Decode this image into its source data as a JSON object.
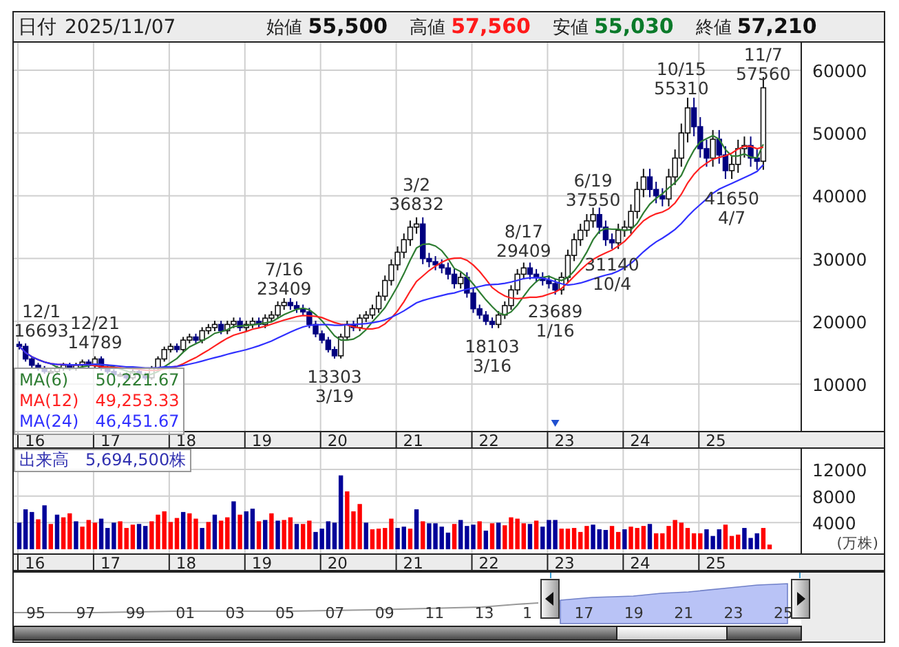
{
  "header": {
    "date_label": "日付",
    "date": "2025/11/07",
    "quotes": [
      {
        "label": "始値",
        "value": "55,500",
        "kind": "neutral"
      },
      {
        "label": "高値",
        "value": "57,560",
        "kind": "up"
      },
      {
        "label": "安値",
        "value": "55,030",
        "kind": "down"
      },
      {
        "label": "終値",
        "value": "57,210",
        "kind": "neutral"
      }
    ]
  },
  "price_chart": {
    "legend": [
      {
        "name": "MA(6)",
        "value": "50,221.67",
        "color": "#2e7d32"
      },
      {
        "name": "MA(12)",
        "value": "49,253.33",
        "color": "#ff2020"
      },
      {
        "name": "MA(24)",
        "value": "46,451.67",
        "color": "#3030ff"
      }
    ],
    "axis_labels": [
      "60000",
      "50000",
      "40000",
      "30000",
      "20000",
      "10000"
    ],
    "annotations": [
      {
        "lines": [
          "12/1",
          "16693"
        ]
      },
      {
        "lines": [
          "12/21",
          "14789"
        ]
      },
      {
        "lines": [
          "7/16",
          "23409"
        ]
      },
      {
        "lines": [
          "13303",
          "3/19"
        ]
      },
      {
        "lines": [
          "3/2",
          "36832"
        ]
      },
      {
        "lines": [
          "18103",
          "3/16"
        ]
      },
      {
        "lines": [
          "8/17",
          "29409"
        ]
      },
      {
        "lines": [
          "23689",
          "1/16"
        ]
      },
      {
        "lines": [
          "6/19",
          "37550"
        ]
      },
      {
        "lines": [
          "31140",
          "10/4"
        ]
      },
      {
        "lines": [
          "10/15",
          "55310"
        ]
      },
      {
        "lines": [
          "41650",
          "4/7"
        ]
      },
      {
        "lines": [
          "11/7",
          "57560"
        ]
      }
    ],
    "x_labels": [
      "16",
      "17",
      "18",
      "19",
      "20",
      "21",
      "22",
      "23",
      "24",
      "25"
    ]
  },
  "volume_chart": {
    "legend_label": "出来高",
    "legend_value": "5,694,500株",
    "x_labels": [
      "16",
      "17",
      "18",
      "19",
      "20",
      "21",
      "22",
      "23",
      "24",
      "25"
    ],
    "chart_data": {
      "type": "bar",
      "stacked": true,
      "grid": true,
      "ylabel": "(万株)",
      "ylim": [
        0,
        12000
      ],
      "yticks": [
        4000,
        8000,
        12000
      ],
      "series": [
        {
          "color": "#ff0000",
          "values": [
            null,
            null,
            null,
            4500,
            null,
            3800,
            null,
            4800,
            5400,
            null,
            3400,
            4400,
            4000,
            null,
            null,
            null,
            4200,
            3200,
            3700,
            null,
            null,
            4200,
            5200,
            5700,
            4100,
            4700,
            null,
            5400,
            4600,
            null,
            4100,
            null,
            4300,
            4800,
            null,
            5200,
            null,
            null,
            4200,
            null,
            5400,
            null,
            4400,
            4800,
            null,
            3800,
            4300,
            null,
            null,
            null,
            null,
            null,
            8700,
            5700,
            6800,
            null,
            3000,
            3100,
            3200,
            4600,
            null,
            null,
            3100,
            null,
            4200,
            null,
            null,
            null,
            null,
            3800,
            null,
            null,
            null,
            4200,
            null,
            3900,
            null,
            3600,
            4800,
            4600,
            3900,
            null,
            4300,
            null,
            null,
            null,
            3100,
            3100,
            3200,
            2600,
            3500,
            null,
            null,
            null,
            3500,
            2600,
            null,
            3400,
            3200,
            3500,
            null,
            2400,
            2400,
            3500,
            4400,
            4000,
            3200,
            2400,
            2400,
            null,
            null,
            null,
            3700,
            2000,
            2200,
            null,
            null,
            null,
            3200,
            700
          ]
        },
        {
          "color": "#000099",
          "values": [
            4000,
            6000,
            5600,
            null,
            6600,
            null,
            5200,
            null,
            null,
            4200,
            null,
            null,
            null,
            4600,
            3200,
            4000,
            null,
            null,
            null,
            3800,
            3500,
            null,
            null,
            null,
            null,
            null,
            5600,
            null,
            null,
            3200,
            null,
            5200,
            null,
            null,
            7200,
            null,
            5700,
            6100,
            null,
            4400,
            null,
            4300,
            null,
            null,
            3800,
            null,
            null,
            2600,
            3100,
            4200,
            4000,
            11100,
            null,
            null,
            null,
            4000,
            null,
            null,
            null,
            null,
            3200,
            3400,
            null,
            6000,
            null,
            3900,
            3900,
            3400,
            2500,
            null,
            4400,
            3500,
            3700,
            null,
            2800,
            null,
            4000,
            null,
            null,
            null,
            null,
            3800,
            null,
            3400,
            4400,
            4400,
            null,
            null,
            null,
            null,
            null,
            3700,
            3000,
            2900,
            null,
            null,
            3000,
            null,
            null,
            null,
            3800,
            null,
            null,
            null,
            null,
            null,
            null,
            null,
            null,
            3000,
            2000,
            3000,
            null,
            null,
            null,
            3200,
            1700,
            2400,
            null,
            null
          ]
        }
      ]
    }
  },
  "navigator": {
    "year_labels": [
      "95",
      "97",
      "99",
      "01",
      "03",
      "05",
      "07",
      "09",
      "11",
      "13",
      "1",
      "17",
      "19",
      "21",
      "23",
      "25"
    ]
  }
}
